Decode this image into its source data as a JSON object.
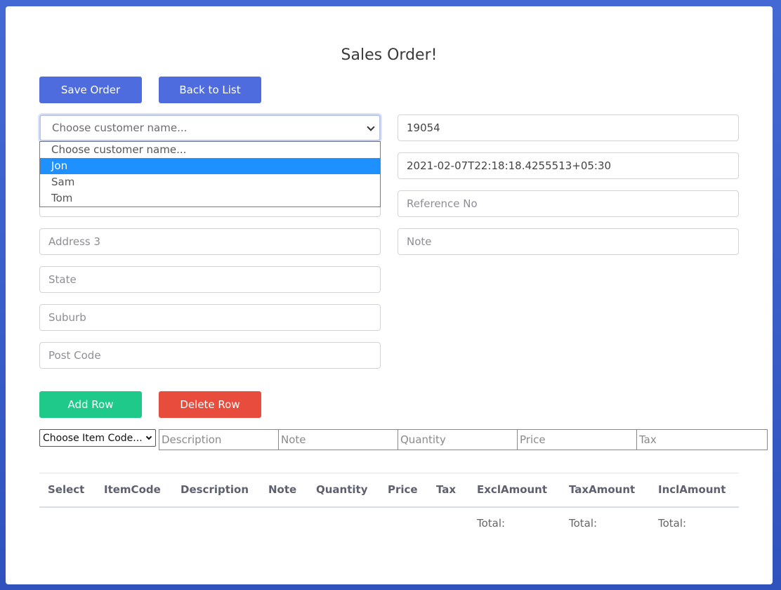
{
  "page": {
    "title": "Sales Order!"
  },
  "buttons": {
    "save": "Save Order",
    "back": "Back to List",
    "add_row": "Add Row",
    "delete_row": "Delete Row"
  },
  "customer_select": {
    "selected": "Choose customer name...",
    "options": [
      "Choose customer name...",
      "Jon",
      "Sam",
      "Tom"
    ],
    "highlighted_index": 1
  },
  "fields": {
    "order_no": "19054",
    "order_date": "2021-02-07T22:18:18.4255513+05:30",
    "reference_placeholder": "Reference No",
    "note_placeholder": "Note",
    "address3_placeholder": "Address 3",
    "state_placeholder": "State",
    "suburb_placeholder": "Suburb",
    "postcode_placeholder": "Post Code"
  },
  "item_row": {
    "item_code_selected": "Choose Item Code...",
    "description_placeholder": "Description",
    "note_placeholder": "Note",
    "quantity_placeholder": "Quantity",
    "price_placeholder": "Price",
    "tax_placeholder": "Tax"
  },
  "table": {
    "headers": [
      "Select",
      "ItemCode",
      "Description",
      "Note",
      "Quantity",
      "Price",
      "Tax",
      "ExclAmount",
      "TaxAmount",
      "InclAmount"
    ],
    "totals": {
      "excl": "Total:",
      "tax": "Total:",
      "incl": "Total:"
    }
  },
  "colors": {
    "primary": "#4e6cde",
    "success": "#1fc98a",
    "danger": "#e74c3c",
    "highlight": "#1e90ff"
  }
}
